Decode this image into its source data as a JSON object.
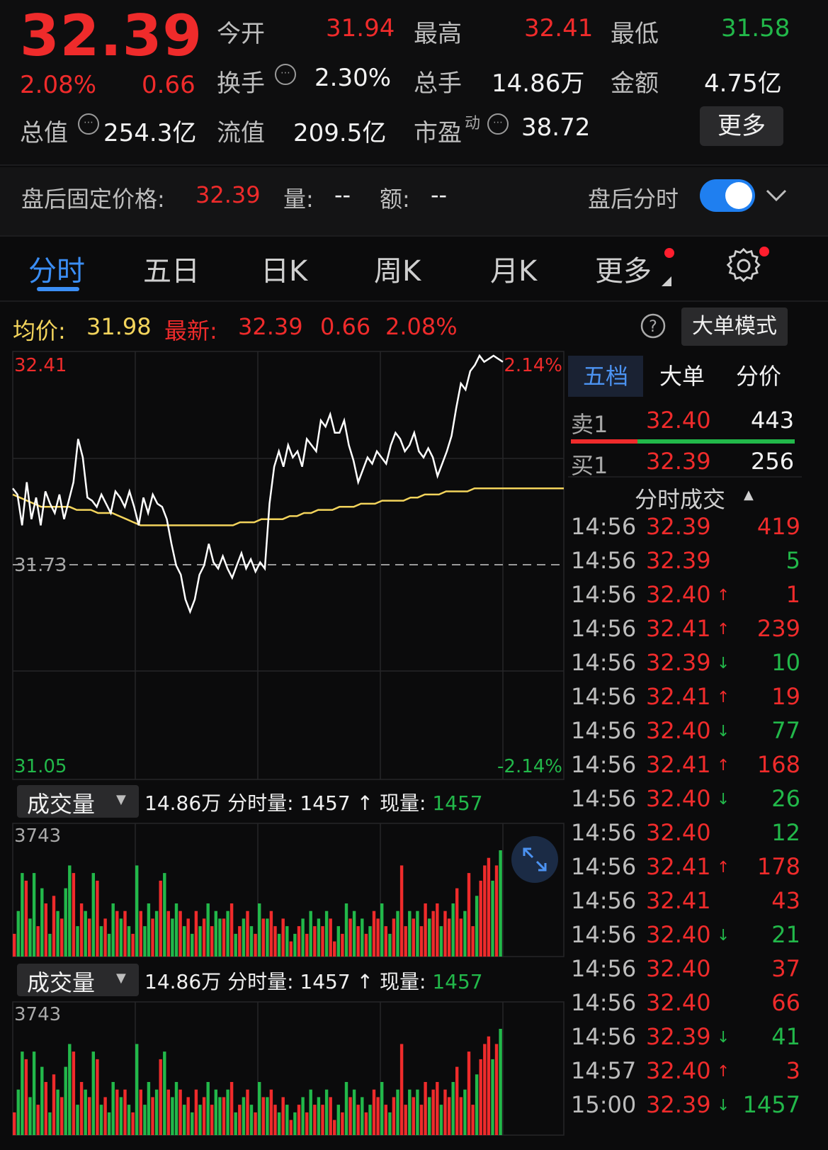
{
  "quote": {
    "price": "32.39",
    "change_pct": "2.08%",
    "change": "0.66",
    "open_label": "今开",
    "open": "31.94",
    "high_label": "最高",
    "high": "32.41",
    "low_label": "最低",
    "low": "31.58",
    "turnover_label": "换手",
    "turnover": "2.30%",
    "volume_label": "总手",
    "volume": "14.86万",
    "amount_label": "金额",
    "amount": "4.75亿",
    "mktcap_label": "总值",
    "mktcap": "254.3亿",
    "float_label": "流值",
    "float": "209.5亿",
    "pe_label": "市盈",
    "pe_sup": "动",
    "pe": "38.72",
    "more_label": "更多",
    "info_icon": "info-circle-icon"
  },
  "after_hours": {
    "label": "盘后固定价格:",
    "price": "32.39",
    "vol_label": "量:",
    "vol": "--",
    "amt_label": "额:",
    "amt": "--",
    "intraday_label": "盘后分时",
    "toggle_on": true
  },
  "tabs": [
    {
      "label": "分时",
      "active": true
    },
    {
      "label": "五日"
    },
    {
      "label": "日K"
    },
    {
      "label": "周K"
    },
    {
      "label": "月K"
    },
    {
      "label": "更多"
    }
  ],
  "summary": {
    "avg_label": "均价:",
    "avg": "31.98",
    "latest_label": "最新:",
    "latest": "32.39",
    "change": "0.66",
    "change_pct": "2.08%",
    "mode_label": "大单模式",
    "help_icon": "help-circle-icon"
  },
  "chart_data": {
    "type": "line",
    "y_top_label": "32.41",
    "y_mid_label": "31.73",
    "y_bottom_label": "31.05",
    "pct_top_label": "2.14%",
    "pct_bottom_label": "-2.14%",
    "ylim": [
      31.05,
      32.41
    ],
    "prev_close": 31.73,
    "series": [
      {
        "values": [
          31.98,
          31.96,
          31.86,
          32.0,
          31.88,
          31.95,
          31.86,
          31.97,
          31.93,
          31.9,
          31.96,
          31.88,
          31.94,
          32.0,
          32.14,
          32.08,
          31.95,
          31.94,
          31.92,
          31.96,
          31.93,
          31.9,
          31.97,
          31.95,
          31.92,
          31.97,
          31.92,
          31.86,
          31.95,
          31.9,
          31.96,
          31.93,
          31.92,
          31.88,
          31.8,
          31.73,
          31.7,
          31.62,
          31.58,
          31.62,
          31.7,
          31.73,
          31.8,
          31.74,
          31.72,
          31.76,
          31.72,
          31.69,
          31.73,
          31.77,
          31.72,
          31.75,
          31.71,
          31.74,
          31.72,
          31.93,
          32.05,
          32.1,
          32.05,
          32.12,
          32.08,
          32.1,
          32.05,
          32.14,
          32.12,
          32.1,
          32.2,
          32.18,
          32.22,
          32.16,
          32.16,
          32.2,
          32.12,
          32.07,
          32.0,
          32.04,
          32.08,
          32.06,
          32.1,
          32.08,
          32.06,
          32.12,
          32.16,
          32.14,
          32.1,
          32.12,
          32.16,
          32.1,
          32.08,
          32.11,
          32.08,
          32.02,
          32.06,
          32.1,
          32.15,
          32.24,
          32.32,
          32.3,
          32.36,
          32.38,
          32.41,
          32.39,
          32.4,
          32.41,
          32.4,
          32.39
        ]
      },
      {
        "values": [
          31.96,
          31.95,
          31.94,
          31.93,
          31.92,
          31.92,
          31.92,
          31.92,
          31.92,
          31.91,
          31.91,
          31.91,
          31.9,
          31.9,
          31.9,
          31.89,
          31.88,
          31.87,
          31.86,
          31.86,
          31.86,
          31.86,
          31.86,
          31.86,
          31.86,
          31.86,
          31.86,
          31.86,
          31.86,
          31.86,
          31.86,
          31.86,
          31.87,
          31.87,
          31.87,
          31.88,
          31.88,
          31.88,
          31.88,
          31.89,
          31.89,
          31.9,
          31.9,
          31.91,
          31.91,
          31.91,
          31.92,
          31.92,
          31.92,
          31.93,
          31.93,
          31.93,
          31.94,
          31.94,
          31.94,
          31.94,
          31.95,
          31.95,
          31.96,
          31.96,
          31.96,
          31.97,
          31.97,
          31.97,
          31.97,
          31.98,
          31.98,
          31.98,
          31.98,
          31.98
        ]
      }
    ]
  },
  "order_book": {
    "tabs": [
      "五档",
      "大单",
      "分价"
    ],
    "sell1_label": "卖1",
    "sell1_price": "32.40",
    "sell1_vol": "443",
    "buy1_label": "买1",
    "buy1_price": "32.39",
    "buy1_vol": "256",
    "ticks_title": "分时成交",
    "ticks": [
      {
        "time": "14:56",
        "price": "32.39",
        "dir": "",
        "vol": "419",
        "color": "red"
      },
      {
        "time": "14:56",
        "price": "32.39",
        "dir": "",
        "vol": "5",
        "color": "green"
      },
      {
        "time": "14:56",
        "price": "32.40",
        "dir": "↑",
        "vol": "1",
        "color": "red"
      },
      {
        "time": "14:56",
        "price": "32.41",
        "dir": "↑",
        "vol": "239",
        "color": "red"
      },
      {
        "time": "14:56",
        "price": "32.39",
        "dir": "↓",
        "vol": "10",
        "color": "green"
      },
      {
        "time": "14:56",
        "price": "32.41",
        "dir": "↑",
        "vol": "19",
        "color": "red"
      },
      {
        "time": "14:56",
        "price": "32.40",
        "dir": "↓",
        "vol": "77",
        "color": "green"
      },
      {
        "time": "14:56",
        "price": "32.41",
        "dir": "↑",
        "vol": "168",
        "color": "red"
      },
      {
        "time": "14:56",
        "price": "32.40",
        "dir": "↓",
        "vol": "26",
        "color": "green"
      },
      {
        "time": "14:56",
        "price": "32.40",
        "dir": "",
        "vol": "12",
        "color": "green"
      },
      {
        "time": "14:56",
        "price": "32.41",
        "dir": "↑",
        "vol": "178",
        "color": "red"
      },
      {
        "time": "14:56",
        "price": "32.41",
        "dir": "",
        "vol": "43",
        "color": "red"
      },
      {
        "time": "14:56",
        "price": "32.40",
        "dir": "↓",
        "vol": "21",
        "color": "green"
      },
      {
        "time": "14:56",
        "price": "32.40",
        "dir": "",
        "vol": "37",
        "color": "red"
      },
      {
        "time": "14:56",
        "price": "32.40",
        "dir": "",
        "vol": "66",
        "color": "red"
      },
      {
        "time": "14:56",
        "price": "32.39",
        "dir": "↓",
        "vol": "41",
        "color": "green"
      },
      {
        "time": "14:57",
        "price": "32.40",
        "dir": "↑",
        "vol": "3",
        "color": "red"
      },
      {
        "time": "15:00",
        "price": "32.39",
        "dir": "↓",
        "vol": "1457",
        "color": "green"
      }
    ]
  },
  "volume_panel": {
    "label": "成交量",
    "total": "14.86万",
    "tick_label": "分时量:",
    "tick_value": "1457",
    "tick_arrow": "↑",
    "now_label": "现量:",
    "now_value": "1457",
    "max_label": "3743",
    "bars": [
      6,
      12,
      22,
      20,
      10,
      22,
      8,
      18,
      14,
      6,
      16,
      12,
      10,
      18,
      24,
      22,
      8,
      14,
      12,
      10,
      22,
      20,
      8,
      10,
      6,
      14,
      12,
      10,
      12,
      8,
      6,
      24,
      12,
      8,
      14,
      10,
      12,
      20,
      22,
      12,
      10,
      14,
      12,
      8,
      10,
      6,
      12,
      8,
      10,
      14,
      8,
      12,
      10,
      10,
      12,
      14,
      6,
      8,
      10,
      12,
      8,
      6,
      14,
      10,
      10,
      12,
      8,
      6,
      10,
      8,
      4,
      6,
      8,
      10,
      6,
      12,
      8,
      10,
      8,
      12,
      10,
      4,
      8,
      6,
      14,
      10,
      12,
      8,
      10,
      6,
      8,
      12,
      10,
      14,
      8,
      6,
      10,
      12,
      24,
      8,
      12,
      10,
      12,
      8,
      14,
      10,
      12,
      14,
      8,
      12,
      10,
      14,
      18,
      10,
      12,
      22,
      8,
      16,
      20,
      24,
      26,
      20,
      24,
      28
    ],
    "bar_colors": [
      "r",
      "g",
      "g",
      "r",
      "g",
      "g",
      "r",
      "g",
      "r",
      "g",
      "r",
      "g",
      "r",
      "g",
      "g",
      "r",
      "g",
      "r",
      "g",
      "r",
      "g",
      "r",
      "g",
      "r",
      "g",
      "g",
      "r",
      "g",
      "r",
      "g",
      "r",
      "g",
      "r",
      "g",
      "g",
      "r",
      "g",
      "r",
      "g",
      "r",
      "g",
      "g",
      "r",
      "g",
      "r",
      "g",
      "r",
      "g",
      "r",
      "g",
      "r",
      "g",
      "g",
      "r",
      "g",
      "r",
      "g",
      "r",
      "g",
      "r",
      "g",
      "r",
      "g",
      "r",
      "g",
      "r",
      "r",
      "g",
      "r",
      "g",
      "r",
      "g",
      "r",
      "g",
      "r",
      "g",
      "r",
      "g",
      "r",
      "g",
      "r",
      "r",
      "g",
      "r",
      "g",
      "r",
      "g",
      "r",
      "g",
      "r",
      "g",
      "r",
      "r",
      "g",
      "r",
      "g",
      "r",
      "g",
      "r",
      "r",
      "g",
      "r",
      "g",
      "r",
      "r",
      "g",
      "r",
      "r",
      "g",
      "r",
      "r",
      "g",
      "r",
      "r",
      "g",
      "r",
      "r",
      "g",
      "r",
      "r",
      "r",
      "g",
      "r",
      "g"
    ]
  },
  "icons": {
    "settings": "gear-icon",
    "expand": "expand-arrows-icon",
    "chevron": "chevron-down-icon"
  },
  "colors": {
    "up": "#ef2b2b",
    "down": "#22b84a",
    "accent": "#3b8ef5",
    "avg_line": "#f3d45c"
  }
}
